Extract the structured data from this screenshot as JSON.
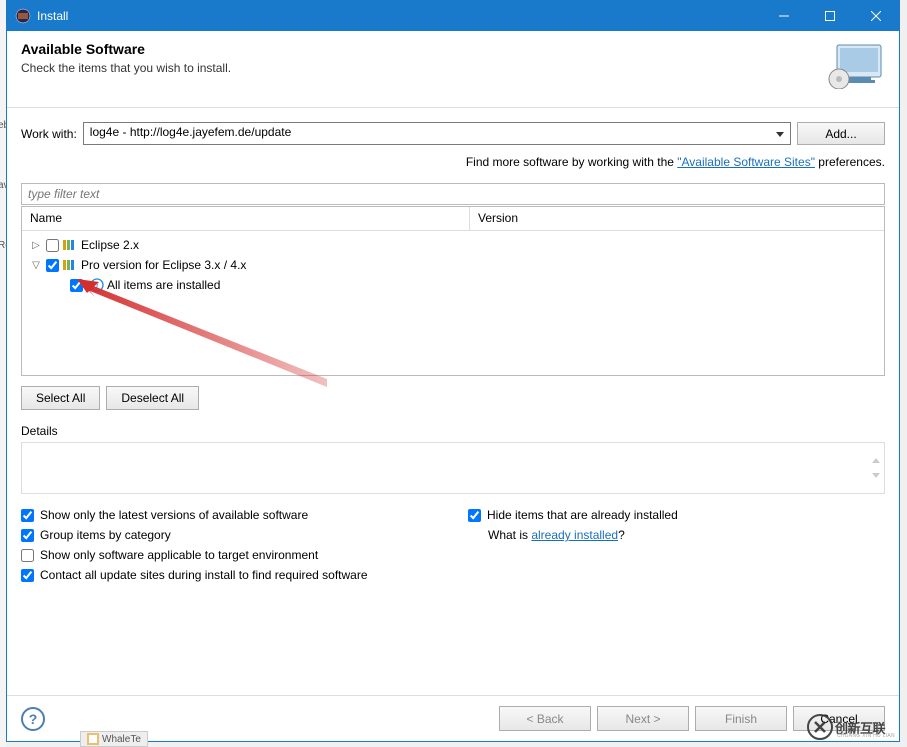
{
  "window": {
    "title": "Install"
  },
  "header": {
    "title": "Available Software",
    "subtitle": "Check the items that you wish to install."
  },
  "workwith": {
    "label": "Work with:",
    "value": "log4e - http://log4e.jayefem.de/update",
    "add_button": "Add..."
  },
  "hint": {
    "prefix": "Find more software by working with the ",
    "link": "\"Available Software Sites\"",
    "suffix": " preferences."
  },
  "filter": {
    "placeholder": "type filter text"
  },
  "tree": {
    "col_name": "Name",
    "col_version": "Version",
    "items": [
      {
        "expanded": false,
        "checked": false,
        "label": "Eclipse 2.x"
      },
      {
        "expanded": true,
        "checked": true,
        "label": "Pro version for Eclipse 3.x / 4.x"
      }
    ],
    "child": {
      "checked": true,
      "label": "All items are installed"
    }
  },
  "buttons": {
    "select_all": "Select All",
    "deselect_all": "Deselect All"
  },
  "details_label": "Details",
  "options": {
    "show_latest": {
      "checked": true,
      "label": "Show only the latest versions of available software"
    },
    "hide_installed": {
      "checked": true,
      "label": "Hide items that are already installed"
    },
    "group_category": {
      "checked": true,
      "label": "Group items by category"
    },
    "whatis_prefix": "What is ",
    "whatis_link": "already installed",
    "whatis_suffix": "?",
    "target_env": {
      "checked": false,
      "label": "Show only software applicable to target environment"
    },
    "contact_sites": {
      "checked": true,
      "label": "Contact all update sites during install to find required software"
    }
  },
  "footer": {
    "back": "< Back",
    "next": "Next >",
    "finish": "Finish",
    "cancel": "Cancel"
  },
  "watermark": {
    "text": "创新互联",
    "sub": "CHUANG XIN HU LIAN"
  },
  "taskbar_stub": "WhaleTe"
}
